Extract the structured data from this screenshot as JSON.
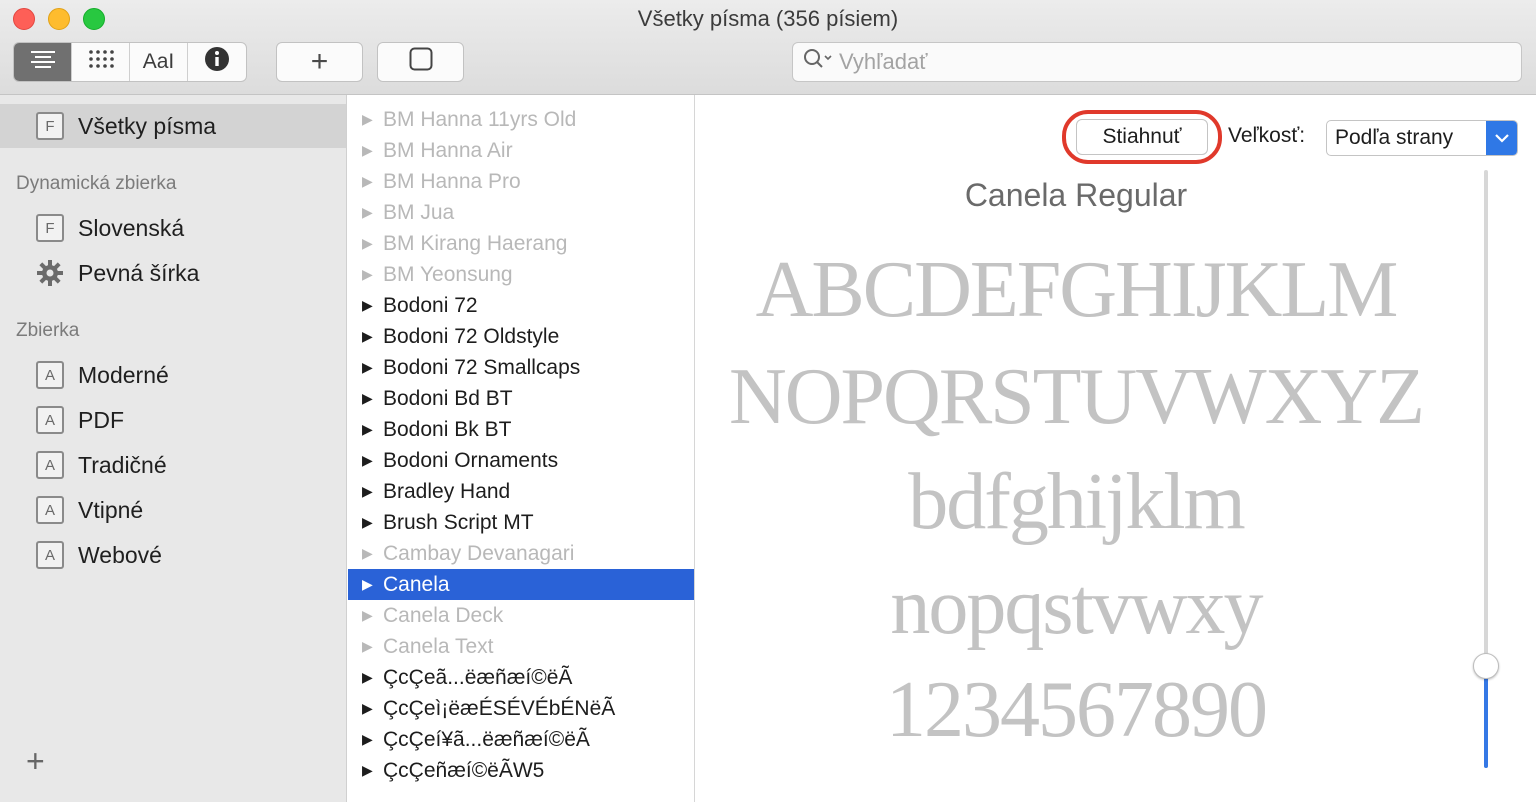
{
  "window": {
    "title": "Všetky písma (356 písiem)"
  },
  "toolbar": {
    "view_modes": [
      {
        "icon": "list-icon",
        "glyph": "☰"
      },
      {
        "icon": "grid-icon",
        "glyph": "⠿"
      },
      {
        "icon": "sample-text-icon",
        "glyph": "AaI"
      },
      {
        "icon": "info-icon",
        "glyph": "ℹ"
      }
    ],
    "add_glyph": "+",
    "collection_glyph": "☐",
    "search_placeholder": "Vyhľadať"
  },
  "sidebar": {
    "top_item": {
      "label": "Všetky písma",
      "icon": "font-icon",
      "glyph": "F"
    },
    "dynamic_header": "Dynamická zbierka",
    "dynamic_items": [
      {
        "label": "Slovenská",
        "icon": "font-icon",
        "glyph": "F"
      },
      {
        "label": "Pevná šírka",
        "icon": "gear-icon"
      }
    ],
    "collection_header": "Zbierka",
    "collection_items": [
      {
        "label": "Moderné",
        "glyph": "A"
      },
      {
        "label": "PDF",
        "glyph": "A"
      },
      {
        "label": "Tradičné",
        "glyph": "A"
      },
      {
        "label": "Vtipné",
        "glyph": "A"
      },
      {
        "label": "Webové",
        "glyph": "A"
      }
    ],
    "add_glyph": "+"
  },
  "font_list": [
    {
      "name": "BM Hanna 11yrs Old",
      "dim": true
    },
    {
      "name": "BM Hanna Air",
      "dim": true
    },
    {
      "name": "BM Hanna Pro",
      "dim": true
    },
    {
      "name": "BM Jua",
      "dim": true
    },
    {
      "name": "BM Kirang Haerang",
      "dim": true
    },
    {
      "name": "BM Yeonsung",
      "dim": true
    },
    {
      "name": "Bodoni 72",
      "dim": false
    },
    {
      "name": "Bodoni 72 Oldstyle",
      "dim": false
    },
    {
      "name": "Bodoni 72 Smallcaps",
      "dim": false
    },
    {
      "name": "Bodoni Bd BT",
      "dim": false
    },
    {
      "name": "Bodoni Bk BT",
      "dim": false
    },
    {
      "name": "Bodoni Ornaments",
      "dim": false
    },
    {
      "name": "Bradley Hand",
      "dim": false
    },
    {
      "name": "Brush Script MT",
      "dim": false
    },
    {
      "name": "Cambay Devanagari",
      "dim": true
    },
    {
      "name": "Canela",
      "dim": false,
      "selected": true
    },
    {
      "name": "Canela Deck",
      "dim": true
    },
    {
      "name": "Canela Text",
      "dim": true
    },
    {
      "name": "ÇcÇeã...ëæñæí©ëÃ",
      "dim": false
    },
    {
      "name": "ÇcÇeì¡ëæÉSÉVÉbÉNëÃ",
      "dim": false
    },
    {
      "name": "ÇcÇeí¥ã...ëæñæí©ëÃ",
      "dim": false
    },
    {
      "name": "ÇcÇeñæí©ëÃW5",
      "dim": false
    }
  ],
  "preview": {
    "download_label": "Stiahnuť",
    "size_label": "Veľkosť:",
    "size_value": "Podľa strany",
    "face_name": "Canela Regular",
    "sample_lines": [
      "ABCDEFGHIJKLM",
      "NOPQRSTUVWXYZ",
      "bdfghijklm",
      "nopqstvwxy",
      "1234567890"
    ],
    "size_slider_fraction": 0.17,
    "accent_color": "#2a62d7",
    "highlight_color": "#e0392b"
  }
}
